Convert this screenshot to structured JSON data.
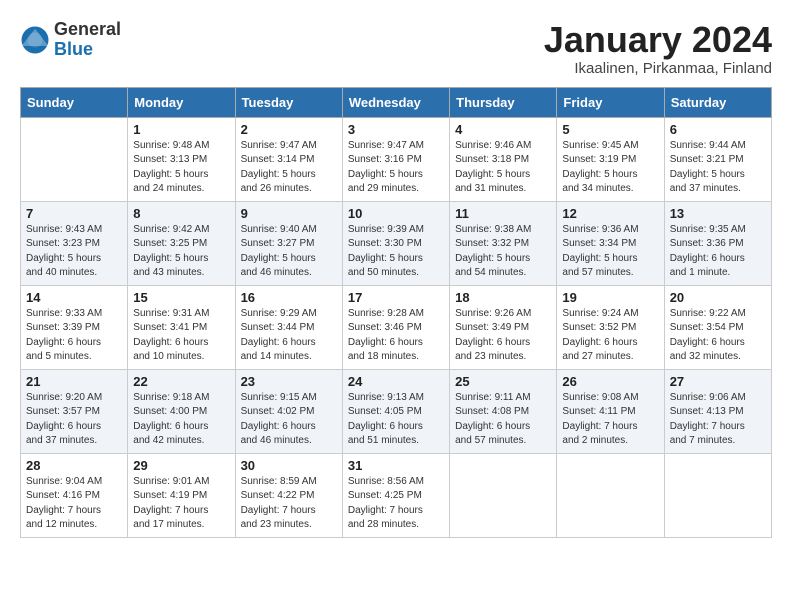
{
  "header": {
    "logo_general": "General",
    "logo_blue": "Blue",
    "month_title": "January 2024",
    "location": "Ikaalinen, Pirkanmaa, Finland"
  },
  "days_of_week": [
    "Sunday",
    "Monday",
    "Tuesday",
    "Wednesday",
    "Thursday",
    "Friday",
    "Saturday"
  ],
  "weeks": [
    [
      {
        "day": "",
        "info": ""
      },
      {
        "day": "1",
        "info": "Sunrise: 9:48 AM\nSunset: 3:13 PM\nDaylight: 5 hours\nand 24 minutes."
      },
      {
        "day": "2",
        "info": "Sunrise: 9:47 AM\nSunset: 3:14 PM\nDaylight: 5 hours\nand 26 minutes."
      },
      {
        "day": "3",
        "info": "Sunrise: 9:47 AM\nSunset: 3:16 PM\nDaylight: 5 hours\nand 29 minutes."
      },
      {
        "day": "4",
        "info": "Sunrise: 9:46 AM\nSunset: 3:18 PM\nDaylight: 5 hours\nand 31 minutes."
      },
      {
        "day": "5",
        "info": "Sunrise: 9:45 AM\nSunset: 3:19 PM\nDaylight: 5 hours\nand 34 minutes."
      },
      {
        "day": "6",
        "info": "Sunrise: 9:44 AM\nSunset: 3:21 PM\nDaylight: 5 hours\nand 37 minutes."
      }
    ],
    [
      {
        "day": "7",
        "info": "Sunrise: 9:43 AM\nSunset: 3:23 PM\nDaylight: 5 hours\nand 40 minutes."
      },
      {
        "day": "8",
        "info": "Sunrise: 9:42 AM\nSunset: 3:25 PM\nDaylight: 5 hours\nand 43 minutes."
      },
      {
        "day": "9",
        "info": "Sunrise: 9:40 AM\nSunset: 3:27 PM\nDaylight: 5 hours\nand 46 minutes."
      },
      {
        "day": "10",
        "info": "Sunrise: 9:39 AM\nSunset: 3:30 PM\nDaylight: 5 hours\nand 50 minutes."
      },
      {
        "day": "11",
        "info": "Sunrise: 9:38 AM\nSunset: 3:32 PM\nDaylight: 5 hours\nand 54 minutes."
      },
      {
        "day": "12",
        "info": "Sunrise: 9:36 AM\nSunset: 3:34 PM\nDaylight: 5 hours\nand 57 minutes."
      },
      {
        "day": "13",
        "info": "Sunrise: 9:35 AM\nSunset: 3:36 PM\nDaylight: 6 hours\nand 1 minute."
      }
    ],
    [
      {
        "day": "14",
        "info": "Sunrise: 9:33 AM\nSunset: 3:39 PM\nDaylight: 6 hours\nand 5 minutes."
      },
      {
        "day": "15",
        "info": "Sunrise: 9:31 AM\nSunset: 3:41 PM\nDaylight: 6 hours\nand 10 minutes."
      },
      {
        "day": "16",
        "info": "Sunrise: 9:29 AM\nSunset: 3:44 PM\nDaylight: 6 hours\nand 14 minutes."
      },
      {
        "day": "17",
        "info": "Sunrise: 9:28 AM\nSunset: 3:46 PM\nDaylight: 6 hours\nand 18 minutes."
      },
      {
        "day": "18",
        "info": "Sunrise: 9:26 AM\nSunset: 3:49 PM\nDaylight: 6 hours\nand 23 minutes."
      },
      {
        "day": "19",
        "info": "Sunrise: 9:24 AM\nSunset: 3:52 PM\nDaylight: 6 hours\nand 27 minutes."
      },
      {
        "day": "20",
        "info": "Sunrise: 9:22 AM\nSunset: 3:54 PM\nDaylight: 6 hours\nand 32 minutes."
      }
    ],
    [
      {
        "day": "21",
        "info": "Sunrise: 9:20 AM\nSunset: 3:57 PM\nDaylight: 6 hours\nand 37 minutes."
      },
      {
        "day": "22",
        "info": "Sunrise: 9:18 AM\nSunset: 4:00 PM\nDaylight: 6 hours\nand 42 minutes."
      },
      {
        "day": "23",
        "info": "Sunrise: 9:15 AM\nSunset: 4:02 PM\nDaylight: 6 hours\nand 46 minutes."
      },
      {
        "day": "24",
        "info": "Sunrise: 9:13 AM\nSunset: 4:05 PM\nDaylight: 6 hours\nand 51 minutes."
      },
      {
        "day": "25",
        "info": "Sunrise: 9:11 AM\nSunset: 4:08 PM\nDaylight: 6 hours\nand 57 minutes."
      },
      {
        "day": "26",
        "info": "Sunrise: 9:08 AM\nSunset: 4:11 PM\nDaylight: 7 hours\nand 2 minutes."
      },
      {
        "day": "27",
        "info": "Sunrise: 9:06 AM\nSunset: 4:13 PM\nDaylight: 7 hours\nand 7 minutes."
      }
    ],
    [
      {
        "day": "28",
        "info": "Sunrise: 9:04 AM\nSunset: 4:16 PM\nDaylight: 7 hours\nand 12 minutes."
      },
      {
        "day": "29",
        "info": "Sunrise: 9:01 AM\nSunset: 4:19 PM\nDaylight: 7 hours\nand 17 minutes."
      },
      {
        "day": "30",
        "info": "Sunrise: 8:59 AM\nSunset: 4:22 PM\nDaylight: 7 hours\nand 23 minutes."
      },
      {
        "day": "31",
        "info": "Sunrise: 8:56 AM\nSunset: 4:25 PM\nDaylight: 7 hours\nand 28 minutes."
      },
      {
        "day": "",
        "info": ""
      },
      {
        "day": "",
        "info": ""
      },
      {
        "day": "",
        "info": ""
      }
    ]
  ]
}
